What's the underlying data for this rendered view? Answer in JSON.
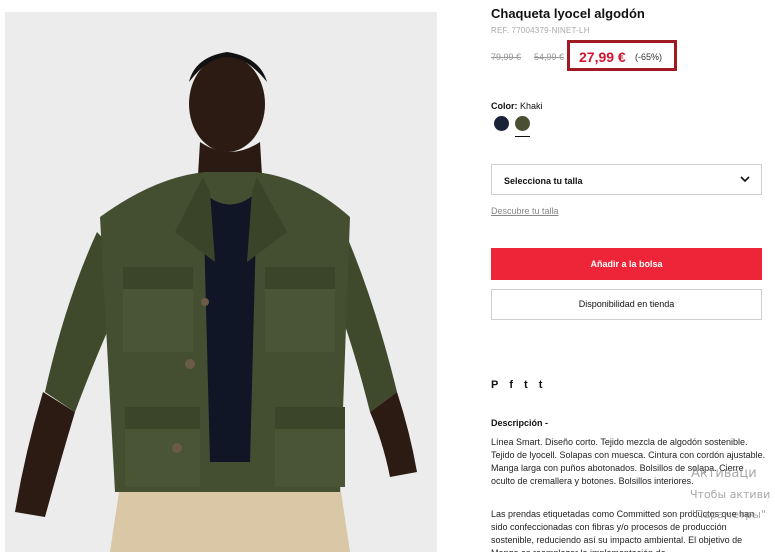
{
  "product": {
    "title": "Chaqueta lyocel algodón",
    "ref": "REF. 77004379-NINET-LH",
    "prices": {
      "original": "79,99 €",
      "previous": "54,99 €",
      "current": "27,99 €",
      "discount": "(-65%)"
    }
  },
  "color": {
    "label": "Color:",
    "value": "Khaki",
    "swatches": [
      {
        "name": "navy",
        "hex": "#1a2238"
      },
      {
        "name": "khaki",
        "hex": "#4a4f34",
        "selected": true
      }
    ]
  },
  "size": {
    "select_label": "Selecciona tu talla",
    "guide_link": "Descubre tu talla"
  },
  "actions": {
    "add_to_bag": "Añadir a la bolsa",
    "store_availability": "Disponibilidad en tienda"
  },
  "social": {
    "icons": [
      "pinterest-icon",
      "facebook-icon",
      "twitter-icon",
      "tumblr-icon"
    ],
    "glyphs": {
      "pinterest": "P",
      "facebook": "f",
      "twitter": "t",
      "tumblr": "t"
    }
  },
  "description": {
    "title": "Descripción -",
    "text": "Línea Smart. Diseño corto. Tejido mezcla de algodón sostenible. Tejido de lyocell. Solapas con muesca. Cintura con cordón ajustable. Manga larga con puños abotonados. Bolsillos de solapa. Cierre oculto de cremallera y botones. Bolsillos interiores.",
    "text2": "Las prendas etiquetadas como Committed son productos que han sido confeccionadas con fibras y/o procesos de producción sostenible, reduciendo así su impacto ambiental. El objetivo de Mango es reemplazar la implementación de"
  },
  "watermark": {
    "line1": "Активаци",
    "line2": "Чтобы активи",
    "line3": "\"Параметры\""
  },
  "colors": {
    "accent_red": "#ee2538",
    "price_red": "#d6142d",
    "highlight_border": "#a01a22"
  }
}
